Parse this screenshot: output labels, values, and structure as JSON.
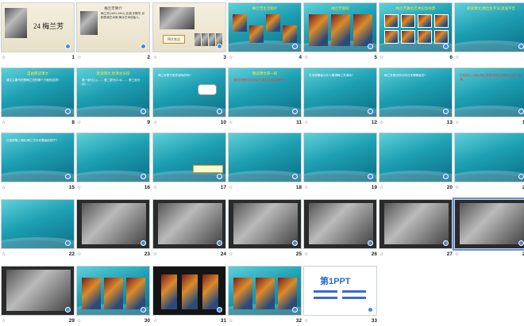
{
  "window_title": "",
  "slides": [
    {
      "num": "1",
      "title": "24 梅兰芳",
      "text": "",
      "kind": "cover"
    },
    {
      "num": "2",
      "title": "梅兰芳简介",
      "text": "梅兰芳(1894-1961),名澜,字畹华,京剧表演艺术家,梅派艺术创始人。",
      "kind": "cream"
    },
    {
      "num": "3",
      "title": "四大名旦",
      "text": "",
      "kind": "photos"
    },
    {
      "num": "4",
      "title": "梅兰芳生活图片",
      "text": "",
      "kind": "teal-photos"
    },
    {
      "num": "5",
      "title": "梅兰芳剧照",
      "text": "",
      "kind": "teal-stage"
    },
    {
      "num": "6",
      "title": "梅兰芳舞台艺术纪念邮票",
      "text": "",
      "kind": "teal-stamps"
    },
    {
      "num": "7",
      "title": "初读课文,圈出生字词,读准字音",
      "text": "",
      "kind": "teal-text"
    },
    {
      "num": "8",
      "title": "自由朗读课文",
      "text": "课文主要写的是梅兰芳的哪个方面的品质?",
      "kind": "teal-text"
    },
    {
      "num": "9",
      "title": "默读课文,给课文分段",
      "text": "第一部分(1):……\n第二部分(2-4):……\n第三部分(5):……",
      "kind": "teal-text"
    },
    {
      "num": "10",
      "title": "",
      "text": "梅兰芳是不愿意演戏的吗?",
      "kind": "teal-bubble"
    },
    {
      "num": "11",
      "title": "精读课文第一段",
      "text": "课文中哪些词句写出了梅兰芳的民族气节?",
      "kind": "teal-red"
    },
    {
      "num": "12",
      "title": "",
      "text": "日本侵略者为什么要请梅兰芳演戏?",
      "kind": "teal-text"
    },
    {
      "num": "13",
      "title": "",
      "text": "梅兰芳是怎样对待日本侵略者的?",
      "kind": "teal-text"
    },
    {
      "num": "14",
      "title": "",
      "text": "日寇侵占上海后,梅兰芳蓄须明志,拒绝为日本人演戏。",
      "kind": "teal-red"
    },
    {
      "num": "15",
      "title": "",
      "text": "日寇侵略上海后,梅兰芳为何要留起胡子?",
      "kind": "teal-text"
    },
    {
      "num": "16",
      "title": "",
      "text": "",
      "kind": "teal-text"
    },
    {
      "num": "17",
      "title": "",
      "text": "",
      "kind": "teal-note"
    },
    {
      "num": "18",
      "title": "",
      "text": "",
      "kind": "teal-text"
    },
    {
      "num": "19",
      "title": "",
      "text": "",
      "kind": "teal-text"
    },
    {
      "num": "20",
      "title": "",
      "text": "",
      "kind": "teal-text"
    },
    {
      "num": "21",
      "title": "",
      "text": "",
      "kind": "teal-red"
    },
    {
      "num": "22",
      "title": "",
      "text": "",
      "kind": "teal-red"
    },
    {
      "num": "23",
      "title": "",
      "text": "",
      "kind": "photo-bw"
    },
    {
      "num": "24",
      "title": "",
      "text": "",
      "kind": "photo-bw"
    },
    {
      "num": "25",
      "title": "",
      "text": "",
      "kind": "photo-bw"
    },
    {
      "num": "26",
      "title": "",
      "text": "",
      "kind": "photo-bw"
    },
    {
      "num": "27",
      "title": "",
      "text": "",
      "kind": "photo-bw"
    },
    {
      "num": "28",
      "title": "",
      "text": "",
      "kind": "photo-bw"
    },
    {
      "num": "29",
      "title": "",
      "text": "",
      "kind": "photo-bw"
    },
    {
      "num": "30",
      "title": "",
      "text": "",
      "kind": "teal-stage"
    },
    {
      "num": "31",
      "title": "",
      "text": "",
      "kind": "dark-stage"
    },
    {
      "num": "32",
      "title": "",
      "text": "",
      "kind": "teal-stage"
    },
    {
      "num": "33",
      "title": "第1PPT",
      "text": "",
      "kind": "brand"
    }
  ]
}
